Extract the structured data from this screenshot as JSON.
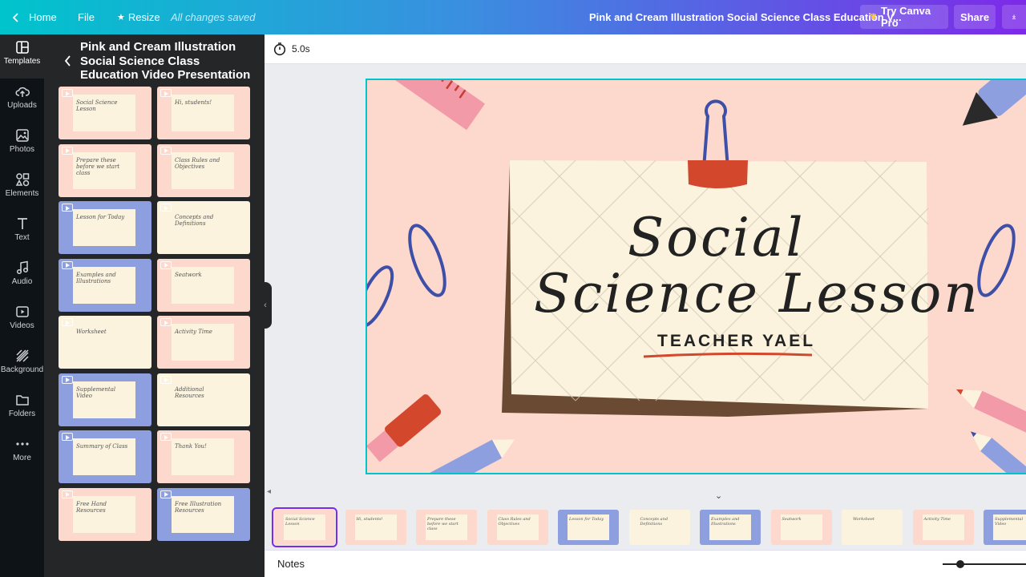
{
  "topbar": {
    "home": "Home",
    "file": "File",
    "resize": "Resize",
    "saved": "All changes saved",
    "doc_title": "Pink and Cream Illustration Social Science Class Education V...",
    "try_pro": "Try Canva Pro",
    "share": "Share"
  },
  "sidebar": {
    "items": [
      {
        "label": "Templates",
        "icon": "templates-icon"
      },
      {
        "label": "Uploads",
        "icon": "cloud-upload-icon"
      },
      {
        "label": "Photos",
        "icon": "image-icon"
      },
      {
        "label": "Elements",
        "icon": "shapes-icon"
      },
      {
        "label": "Text",
        "icon": "text-icon"
      },
      {
        "label": "Audio",
        "icon": "music-note-icon"
      },
      {
        "label": "Videos",
        "icon": "video-icon"
      },
      {
        "label": "Background",
        "icon": "background-hatch-icon"
      },
      {
        "label": "Folders",
        "icon": "folder-icon"
      },
      {
        "label": "More",
        "icon": "more-dots-icon"
      }
    ]
  },
  "panel": {
    "title": "Pink and Cream Illustration Social Science Class Education Video Presentation",
    "thumbs": [
      {
        "bg": "#fcd8cd",
        "text": "Social Science Lesson"
      },
      {
        "bg": "#fcd8cd",
        "text": "Hi, students!"
      },
      {
        "bg": "#fcd8cd",
        "text": "Prepare these before we start class"
      },
      {
        "bg": "#fcd8cd",
        "text": "Class Rules and Objectives"
      },
      {
        "bg": "#8e9fe0",
        "text": "Lesson for Today"
      },
      {
        "bg": "#fbf3dd",
        "text": "Concepts and Definitions"
      },
      {
        "bg": "#8e9fe0",
        "text": "Examples and Illustrations"
      },
      {
        "bg": "#fcd8cd",
        "text": "Seatwork"
      },
      {
        "bg": "#fbf3dd",
        "text": "Worksheet"
      },
      {
        "bg": "#fcd8cd",
        "text": "Activity Time"
      },
      {
        "bg": "#8e9fe0",
        "text": "Supplemental Video"
      },
      {
        "bg": "#fbf3dd",
        "text": "Additional Resources"
      },
      {
        "bg": "#8e9fe0",
        "text": "Summary of Class"
      },
      {
        "bg": "#fcd8cd",
        "text": "Thank You!"
      },
      {
        "bg": "#fcd8cd",
        "text": "Free Hand Resources"
      },
      {
        "bg": "#8e9fe0",
        "text": "Free Illustration Resources"
      }
    ]
  },
  "toolbar": {
    "duration": "5.0s"
  },
  "slide": {
    "title_line1": "Social",
    "title_line2": "Science Lesson",
    "subtitle": "TEACHER YAEL",
    "bg_color": "#fcd8cd"
  },
  "notes": {
    "label": "Notes"
  },
  "colors": {
    "accent": "#00c4cc",
    "pink": "#fcd8cd",
    "blue": "#8e9fe0",
    "cream": "#fbf3dd"
  }
}
